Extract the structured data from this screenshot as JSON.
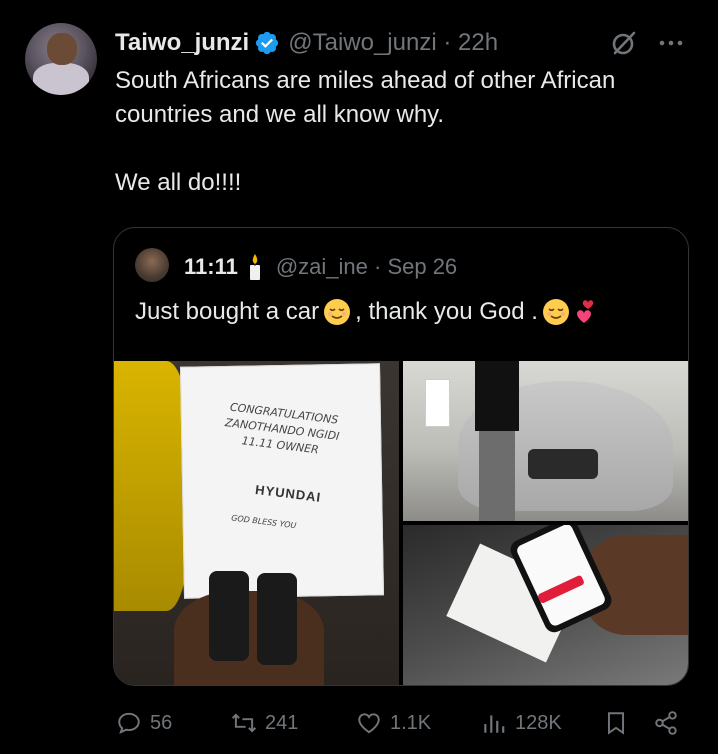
{
  "tweet": {
    "display_name": "Taiwo_junzi",
    "handle_time": "@Taiwo_junzi · 22h",
    "text": "South Africans are miles ahead of other African countries and we all know why.\n\nWe all do!!!!"
  },
  "quote": {
    "name": "11:11",
    "handle_time": "@zai_ine · Sep 26",
    "text_part1": "Just bought a car",
    "text_part2": ", thank you God .",
    "media": {
      "card_lines": [
        "CONGRATULATIONS",
        "ZANOTHANDO NGIDI",
        "11.11 OWNER"
      ],
      "card_brand": "HYUNDAI",
      "card_footer": "GOD BLESS YOU"
    }
  },
  "actions": {
    "replies": "56",
    "reposts": "241",
    "likes": "1.1K",
    "views": "128K"
  },
  "colors": {
    "background": "#000000",
    "text": "#e7e9ea",
    "secondary": "#71767b",
    "verified": "#1d9bf0",
    "border": "#333639"
  }
}
